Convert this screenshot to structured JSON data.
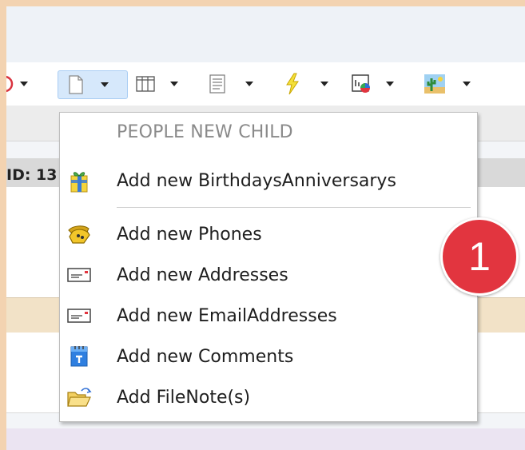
{
  "record": {
    "id_label": "ID: 13"
  },
  "menu": {
    "header": "PEOPLE  NEW CHILD",
    "items": [
      {
        "label": "Add new BirthdaysAnniversarys",
        "icon": "gift-icon"
      },
      {
        "label": "Add new Phones",
        "icon": "phone-icon"
      },
      {
        "label": "Add new Addresses",
        "icon": "address-card-icon"
      },
      {
        "label": "Add new EmailAddresses",
        "icon": "email-card-icon"
      },
      {
        "label": "Add new Comments",
        "icon": "comment-note-icon"
      },
      {
        "label": "Add FileNote(s)",
        "icon": "folder-open-icon"
      }
    ]
  },
  "badge": {
    "text": "1",
    "color": "#e2353f"
  },
  "toolbar": {
    "icons": [
      "record-icon",
      "new-document-icon",
      "table-columns-icon",
      "text-lines-icon",
      "lightning-icon",
      "chart-icon",
      "cactus-image-icon"
    ]
  }
}
